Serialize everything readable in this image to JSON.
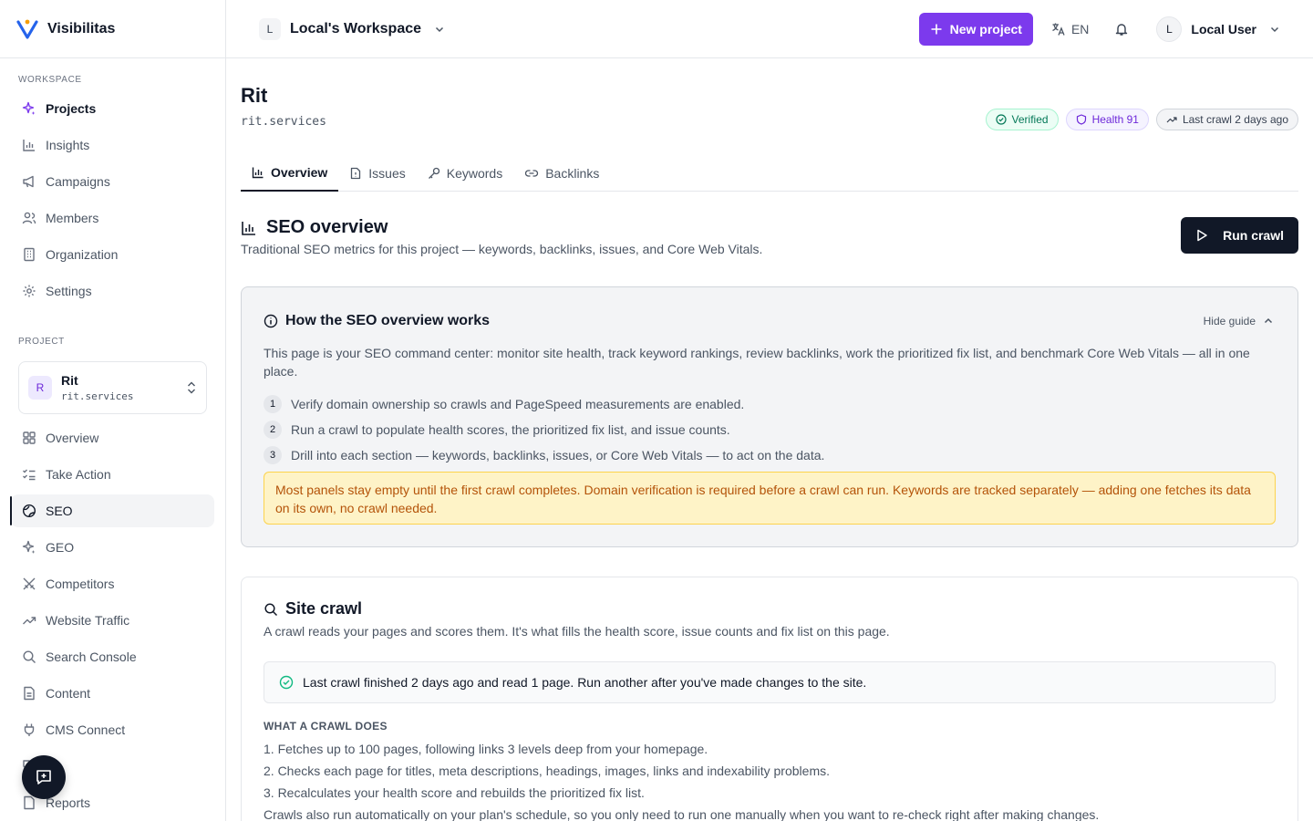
{
  "brand": {
    "name": "Visibilitas"
  },
  "sidebar": {
    "workspace_label": "WORKSPACE",
    "workspace_items": [
      {
        "label": "Projects"
      },
      {
        "label": "Insights"
      },
      {
        "label": "Campaigns"
      },
      {
        "label": "Members"
      },
      {
        "label": "Organization"
      },
      {
        "label": "Settings"
      }
    ],
    "project_label": "PROJECT",
    "project_card": {
      "initial": "R",
      "name": "Rit",
      "domain": "rit.services"
    },
    "project_items": [
      {
        "label": "Overview"
      },
      {
        "label": "Take Action"
      },
      {
        "label": "SEO"
      },
      {
        "label": "GEO"
      },
      {
        "label": "Competitors"
      },
      {
        "label": "Website Traffic"
      },
      {
        "label": "Search Console"
      },
      {
        "label": "Content"
      },
      {
        "label": "CMS Connect"
      },
      {
        "label": "es"
      },
      {
        "label": "Reports"
      }
    ]
  },
  "topbar": {
    "workspace_initial": "L",
    "workspace_name": "Local's Workspace",
    "new_project_label": "New project",
    "language": "EN",
    "user_initial": "L",
    "user_name": "Local User"
  },
  "project": {
    "title": "Rit",
    "domain": "rit.services",
    "badges": {
      "verified": "Verified",
      "health": "Health 91",
      "last_crawl": "Last crawl 2 days ago"
    }
  },
  "tabs": [
    {
      "label": "Overview"
    },
    {
      "label": "Issues"
    },
    {
      "label": "Keywords"
    },
    {
      "label": "Backlinks"
    }
  ],
  "seo": {
    "title": "SEO overview",
    "description": "Traditional SEO metrics for this project — keywords, backlinks, issues, and Core Web Vitals.",
    "run_crawl_label": "Run crawl"
  },
  "guide": {
    "title": "How the SEO overview works",
    "hide_label": "Hide guide",
    "intro": "This page is your SEO command center: monitor site health, track keyword rankings, review backlinks, work the prioritized fix list, and benchmark Core Web Vitals — all in one place.",
    "steps": [
      {
        "num": "1",
        "text": "Verify domain ownership so crawls and PageSpeed measurements are enabled."
      },
      {
        "num": "2",
        "text": "Run a crawl to populate health scores, the prioritized fix list, and issue counts."
      },
      {
        "num": "3",
        "text": "Drill into each section — keywords, backlinks, issues, or Core Web Vitals — to act on the data."
      }
    ],
    "note": "Most panels stay empty until the first crawl completes. Domain verification is required before a crawl can run. Keywords are tracked separately — adding one fetches its data on its own, no crawl needed."
  },
  "crawl": {
    "title": "Site crawl",
    "description": "A crawl reads your pages and scores them. It's what fills the health score, issue counts and fix list on this page.",
    "status": "Last crawl finished 2 days ago and read 1 page. Run another after you've made changes to the site.",
    "what_label": "WHAT A CRAWL DOES",
    "what_items": [
      "1. Fetches up to 100 pages, following links 3 levels deep from your homepage.",
      "2. Checks each page for titles, meta descriptions, headings, images, links and indexability problems.",
      "3. Recalculates your health score and rebuilds the prioritized fix list."
    ],
    "footer": "Crawls also run automatically on your plan's schedule, so you only need to run one manually when you want to re-check right after making changes."
  },
  "colors": {
    "accent": "#7c3aed",
    "dark": "#111827",
    "success": "#047857",
    "warning": "#b45309"
  }
}
